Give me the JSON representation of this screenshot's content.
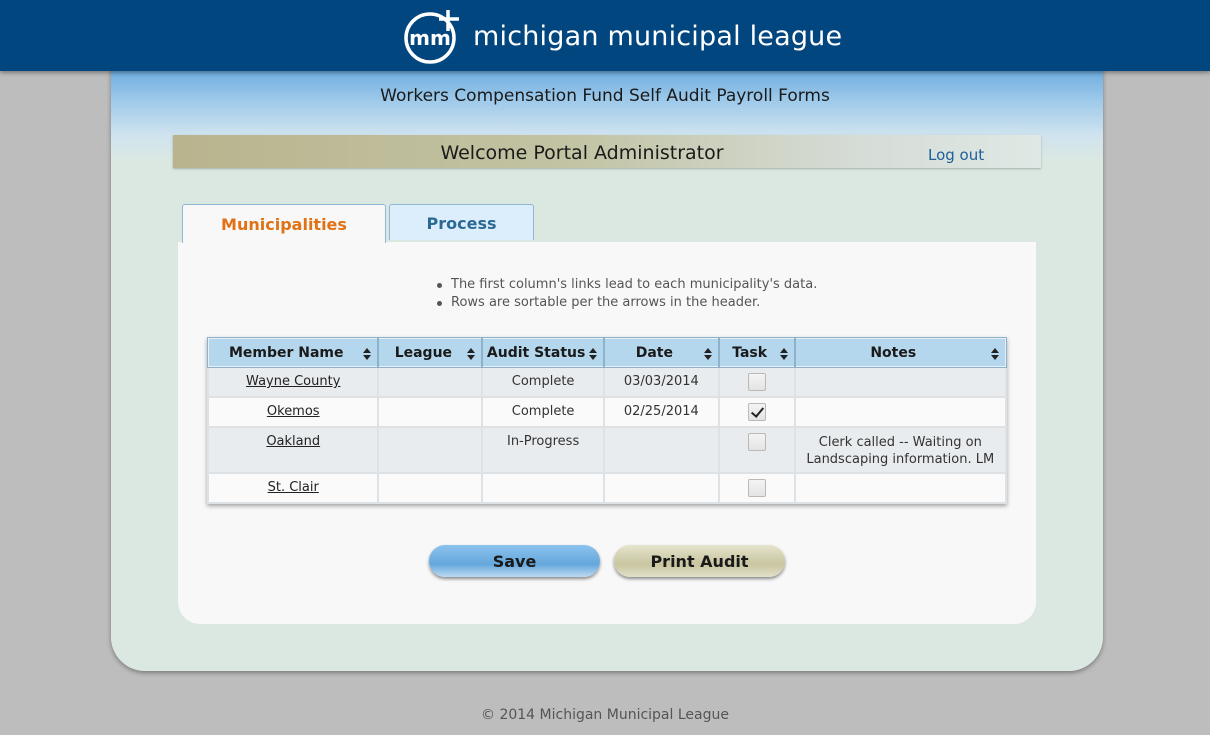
{
  "header": {
    "brand_name": "michigan municipal league",
    "logo_icon": "mml-logo-icon",
    "background_color": "#02467f"
  },
  "page_title": "Workers Compensation Fund Self Audit Payroll Forms",
  "welcome": {
    "text": "Welcome Portal Administrator",
    "logout_label": "Log out"
  },
  "tabs": [
    {
      "label": "Municipalities",
      "active": true
    },
    {
      "label": "Process",
      "active": false
    }
  ],
  "instructions": [
    "The first column's links lead to each municipality's data.",
    "Rows are sortable per the arrows in the header."
  ],
  "table": {
    "columns": [
      "Member Name",
      "League",
      "Audit Status",
      "Date",
      "Task",
      "Notes"
    ],
    "sort_icon": "sort-arrows-icon",
    "rows": [
      {
        "member": "Wayne County",
        "league": "",
        "status": "Complete",
        "date": "03/03/2014",
        "task": false,
        "notes": ""
      },
      {
        "member": "Okemos",
        "league": "",
        "status": "Complete",
        "date": "02/25/2014",
        "task": true,
        "notes": ""
      },
      {
        "member": "Oakland",
        "league": "",
        "status": "In-Progress",
        "date": "",
        "task": false,
        "notes": "Clerk called -- Waiting on Landscaping information. LM"
      },
      {
        "member": "St. Clair",
        "league": "",
        "status": "",
        "date": "",
        "task": false,
        "notes": ""
      }
    ]
  },
  "buttons": {
    "save_label": "Save",
    "print_label": "Print Audit"
  },
  "footer": "© 2014 Michigan Municipal League",
  "colors": {
    "accent_orange": "#e07215",
    "link_blue": "#1d5f99",
    "header_blue": "#b5d7ee"
  }
}
